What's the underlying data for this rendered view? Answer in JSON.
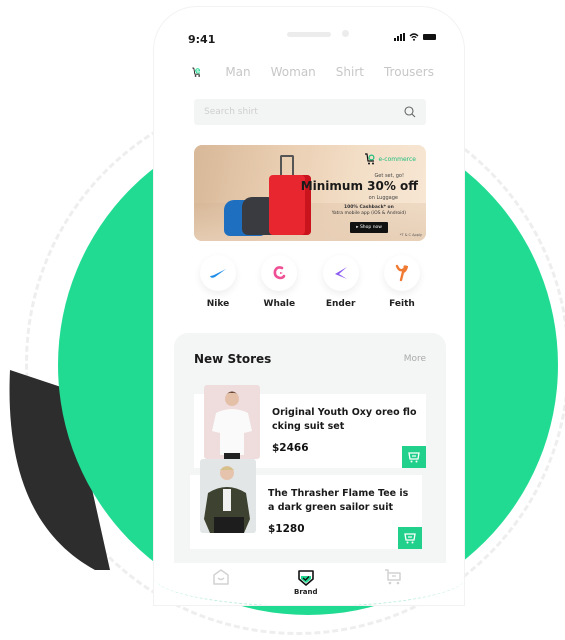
{
  "status_bar": {
    "time": "9:41"
  },
  "top_nav": {
    "logo": "e-commerce-cart-logo",
    "items": [
      {
        "label": "Man"
      },
      {
        "label": "Woman"
      },
      {
        "label": "Shirt"
      },
      {
        "label": "Trousers"
      }
    ]
  },
  "search": {
    "placeholder": "Search shirt",
    "icon": "search-icon"
  },
  "banner": {
    "logo_text": "e-commerce",
    "subtitle": "Get set, go!",
    "title": "Minimum 30% off",
    "on_text": "on Luggage",
    "cashback_line1": "100% Cashback* on",
    "cashback_line2": "Yatra mobile app (iOS & Android)",
    "cta": "▸ Shop now",
    "terms": "*T & C Apply"
  },
  "brands": [
    {
      "label": "Nike",
      "icon": "nike-swoosh-icon",
      "color": "#1e8ee8"
    },
    {
      "label": "Whale",
      "icon": "whale-logo-icon",
      "color": "#ef4f95"
    },
    {
      "label": "Ender",
      "icon": "ender-logo-icon",
      "color": "#8b5cf0"
    },
    {
      "label": "Feith",
      "icon": "feith-logo-icon",
      "color": "#f07a32"
    }
  ],
  "new_stores": {
    "title": "New Stores",
    "more_label": "More",
    "products": [
      {
        "title": "Original Youth Oxy oreo flo cking suit set",
        "price": "$2466"
      },
      {
        "title": "The Thrasher Flame Tee is a dark green sailor suit",
        "price": "$1280"
      }
    ]
  },
  "bottom_nav": {
    "items": [
      {
        "label": "",
        "icon": "home-icon"
      },
      {
        "label": "Brand",
        "icon": "brand-shield-check-icon",
        "active": true
      },
      {
        "label": "",
        "icon": "cart-icon"
      }
    ]
  },
  "colors": {
    "accent": "#21db93",
    "dark": "#2d2d2d",
    "text": "#1b1b1b",
    "muted": "#c7c7c7"
  }
}
